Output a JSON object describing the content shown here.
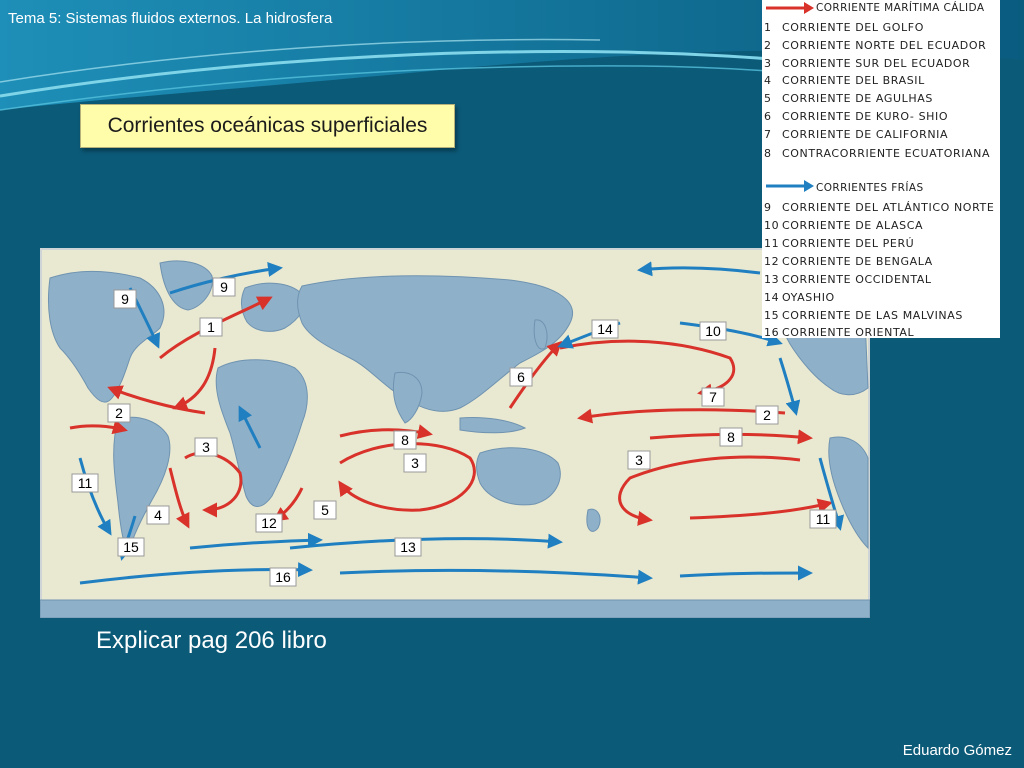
{
  "header": {
    "title": "Tema 5: Sistemas fluidos externos. La hidrosfera"
  },
  "section_title": "Corrientes oceánicas superficiales",
  "legend": {
    "warm_heading": "Corriente marítima cálida",
    "warm_items": [
      {
        "num": "1",
        "label": "Corriente del Golfo"
      },
      {
        "num": "2",
        "label": "Corriente norte del Ecuador"
      },
      {
        "num": "3",
        "label": "Corriente sur del Ecuador"
      },
      {
        "num": "4",
        "label": "Corriente del Brasil"
      },
      {
        "num": "5",
        "label": "Corriente de Agulhas"
      },
      {
        "num": "6",
        "label": "Corriente de Kuro- Shio"
      },
      {
        "num": "7",
        "label": "Corriente de California"
      },
      {
        "num": "8",
        "label": "Contracorriente ecuatoriana"
      }
    ],
    "cold_heading": "Corrientes frías",
    "cold_items": [
      {
        "num": "9",
        "label": "Corriente del Atlántico norte"
      },
      {
        "num": "10",
        "label": "Corriente de Alasca"
      },
      {
        "num": "11",
        "label": "Corriente del Perú"
      },
      {
        "num": "12",
        "label": "Corriente de Bengala"
      },
      {
        "num": "13",
        "label": "Corriente occidental"
      },
      {
        "num": "14",
        "label": "Oyashio"
      },
      {
        "num": "15",
        "label": "Corriente de las malvinas"
      },
      {
        "num": "16",
        "label": "Corriente oriental"
      }
    ],
    "warm_color": "#d8322a",
    "cold_color": "#1f7fc0"
  },
  "map_labels": [
    "9",
    "9",
    "1",
    "2",
    "3",
    "4",
    "15",
    "11",
    "12",
    "5",
    "13",
    "16",
    "8",
    "3",
    "6",
    "14",
    "10",
    "7",
    "2",
    "8",
    "3",
    "11"
  ],
  "footer": {
    "note": "Explicar pag 206 libro",
    "author": "Eduardo Gómez"
  },
  "colors": {
    "background": "#0b5a78",
    "ocean": "#7aa8c4",
    "land": "#e8e8d0",
    "warm": "#d8322a",
    "cold": "#1f7fc0",
    "title_box": "#fffcaa"
  }
}
